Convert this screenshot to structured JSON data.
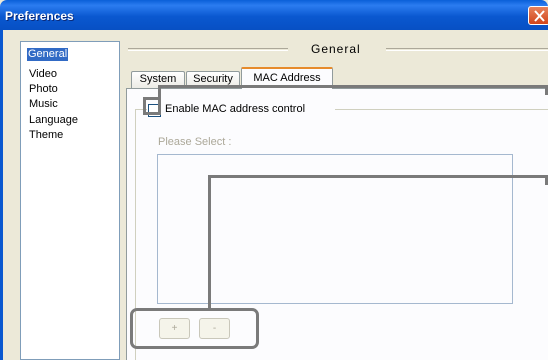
{
  "window": {
    "title": "Preferences"
  },
  "sidebar": {
    "items": [
      {
        "label": "General",
        "selected": true
      },
      {
        "label": "Video"
      },
      {
        "label": "Photo"
      },
      {
        "label": "Music"
      },
      {
        "label": "Language"
      },
      {
        "label": "Theme"
      }
    ]
  },
  "section": {
    "title": "General"
  },
  "tabs": [
    {
      "label": "System"
    },
    {
      "label": "Security"
    },
    {
      "label": "MAC Address",
      "active": true
    }
  ],
  "mac": {
    "enable_label": "Enable MAC address control",
    "enable_checked": false,
    "please_select": "Please Select :",
    "add_label": "+",
    "remove_label": "-"
  },
  "colors": {
    "titlebar": "#0a58d0",
    "selection": "#316ac5",
    "callout": "#7a7a7a",
    "active_tab_accent": "#e68b2c"
  }
}
